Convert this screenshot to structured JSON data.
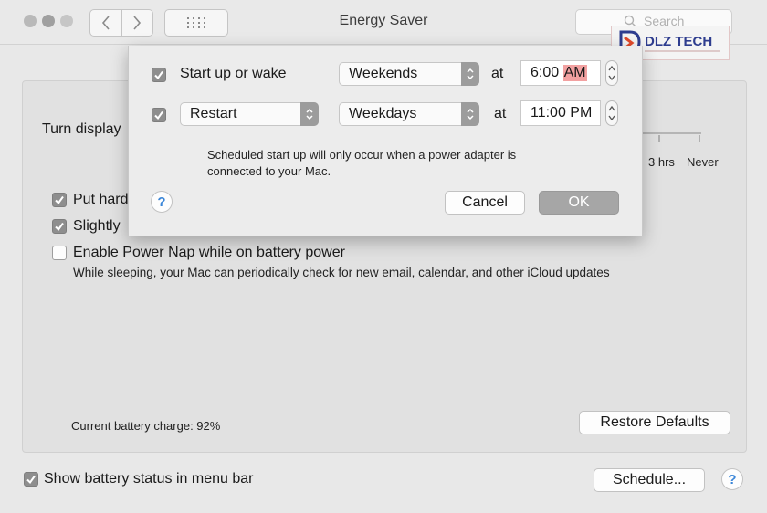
{
  "window": {
    "title": "Energy Saver"
  },
  "toolbar": {
    "search_placeholder": "Search"
  },
  "watermark": {
    "text": "DLZ TECH"
  },
  "main": {
    "turn_display_label": "Turn display",
    "slider_labels": [
      "3 hrs",
      "Never"
    ],
    "options": [
      {
        "label": "Put hard",
        "checked": true
      },
      {
        "label": "Slightly",
        "checked": true
      },
      {
        "label": "Enable Power Nap while on battery power",
        "checked": false
      }
    ],
    "power_nap_description": "While sleeping, your Mac can periodically check for new email, calendar, and other iCloud updates",
    "battery_charge": "Current battery charge: 92%",
    "restore_defaults_label": "Restore Defaults"
  },
  "footer": {
    "show_battery_status_label": "Show battery status in menu bar",
    "show_battery_status_checked": true,
    "schedule_label": "Schedule..."
  },
  "schedule_sheet": {
    "startup": {
      "label": "Start up or wake",
      "checked": true,
      "days": "Weekends",
      "at_label": "at",
      "time": "6:00",
      "ampm": "AM"
    },
    "action": {
      "checked": true,
      "action": "Restart",
      "days": "Weekdays",
      "at_label": "at",
      "time": "11:00 PM"
    },
    "note_line1": "Scheduled start up will only occur when a power adapter is",
    "note_line2": "connected to your Mac.",
    "cancel_label": "Cancel",
    "ok_label": "OK"
  },
  "help_label": "?",
  "colors": {
    "accent": "#3b86d8",
    "selection": "#f2a1a1",
    "checkbox": "#8e8e8e"
  }
}
